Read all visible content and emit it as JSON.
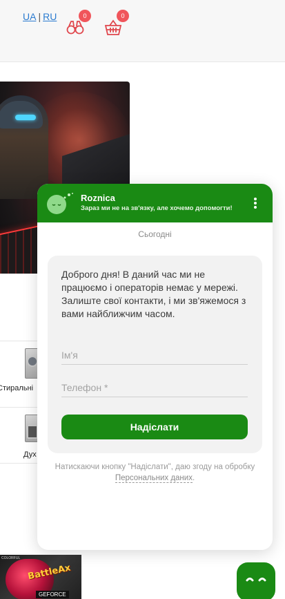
{
  "header": {
    "lang_ua": "UA",
    "lang_sep": "|",
    "lang_ru": "RU",
    "compare_count": "0",
    "cart_count": "0",
    "compare_icon": "binoculars-icon",
    "cart_icon": "basket-icon"
  },
  "page": {
    "categories": [
      {
        "label": "Стиральні",
        "icon": "washing-machine-icon"
      },
      {
        "label": "Дух",
        "icon": "oven-icon"
      }
    ],
    "bottom_banner": {
      "brand": "COLORFUL",
      "title": "BattleAx",
      "badge": "GEFORCE"
    }
  },
  "chat": {
    "title": "Roznica",
    "subtitle": "Зараз ми не на зв'язку, але хочемо допомогти!",
    "date_divider": "Сьогодні",
    "message": "Доброго дня! В даний час ми не працюємо і операторів немає у мережі. Залиште свої контакти, і ми зв'яжемося з вами найближчим часом.",
    "name_placeholder": "Ім'я",
    "phone_placeholder": "Телефон *",
    "send_label": "Надіслати",
    "consent_text": "Натискаючи кнопку \"Надіслати\", даю згоду на обробку ",
    "consent_link": "Персональних даних",
    "consent_end": "."
  },
  "colors": {
    "brand_green": "#1a8a14",
    "badge_red": "#f0555b",
    "link_blue": "#2b7bd0"
  }
}
